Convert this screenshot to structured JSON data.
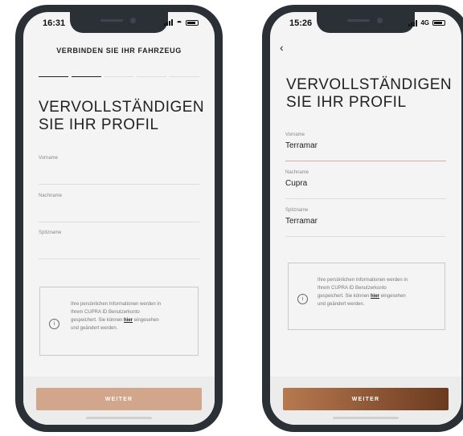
{
  "left_phone": {
    "status_time": "16:31",
    "header_title": "VERBINDEN SIE IHR FAHRZEUG",
    "progress_steps": 5,
    "progress_done": 2,
    "title_line1": "VERVOLLSTÄNDIGEN",
    "title_line2": "SIE IHR PROFIL",
    "fields": [
      {
        "label": "Vorname",
        "value": ""
      },
      {
        "label": "Nachname",
        "value": ""
      },
      {
        "label": "Spitzname",
        "value": ""
      }
    ],
    "info": {
      "line1": "Ihre persönlichen Informationen werden in",
      "line2": "Ihrem CUPRA ID Benutzerkonto",
      "line3_pre": "gespeichert. Sie können ",
      "link": "hier",
      "line3_post": " eingesehen",
      "line4": "und geändert werden."
    },
    "button_label": "WEITER",
    "button_color": "#d2a68a"
  },
  "right_phone": {
    "status_time": "15:26",
    "network": "4G",
    "back_icon": "chevron-left-icon",
    "title_line1": "VERVOLLSTÄNDIGEN",
    "title_line2": "SIE IHR PROFIL",
    "fields": [
      {
        "label": "Vorname",
        "value": "Terramar"
      },
      {
        "label": "Nachname",
        "value": "Cupra"
      },
      {
        "label": "Spitzname",
        "value": "Terramar"
      }
    ],
    "info": {
      "line1": "Ihre persönlichen Informationen werden in",
      "line2": "Ihrem CUPRA ID Benutzerkonto",
      "line3_pre": "gespeichert. Sie können ",
      "link": "hier",
      "line3_post": " eingesehen",
      "line4": "und geändert werden."
    },
    "button_label": "WEITER",
    "button_color_start": "#b77a4f",
    "button_color_end": "#6b3a1f"
  }
}
